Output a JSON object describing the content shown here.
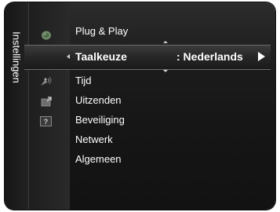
{
  "side_tab": {
    "label": "Instellingen"
  },
  "menu": {
    "items": [
      {
        "label": "Plug & Play"
      },
      {
        "label": "Taalkeuze",
        "value": ": Nederlands",
        "selected": true
      },
      {
        "label": "Tijd"
      },
      {
        "label": "Uitzenden"
      },
      {
        "label": "Beveiliging"
      },
      {
        "label": "Netwerk"
      },
      {
        "label": "Algemeen"
      }
    ]
  },
  "icons": [
    "picture-icon",
    "settings-gear-icon",
    "antenna-icon",
    "application-icon",
    "support-icon"
  ],
  "colors": {
    "background": "#161616",
    "text": "#ffffff",
    "selection": "#2e2e2e"
  }
}
